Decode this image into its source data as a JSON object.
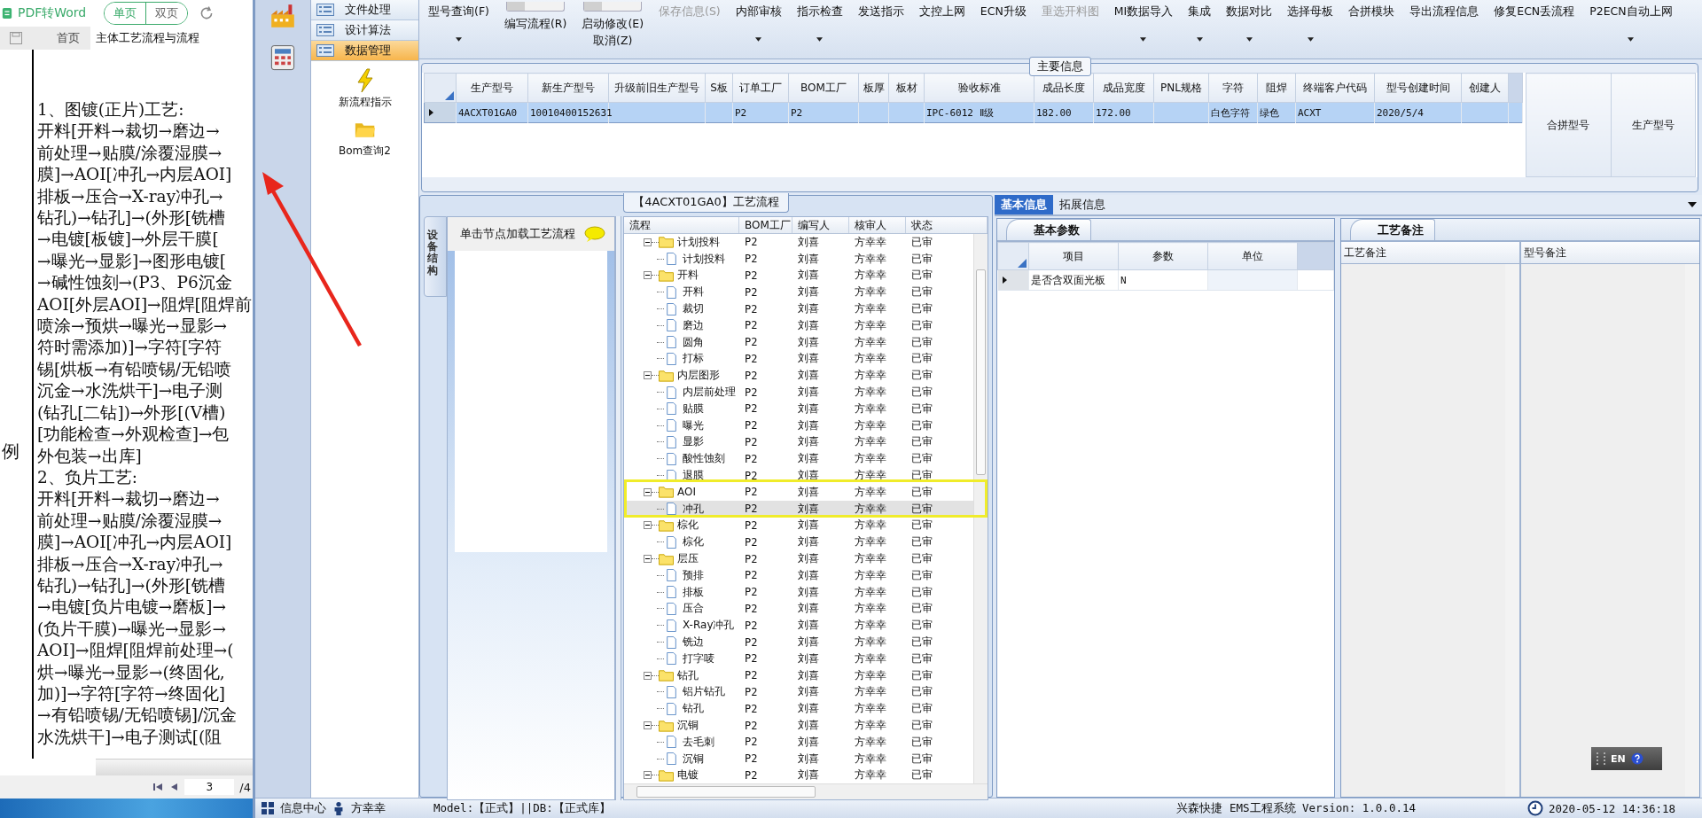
{
  "doc_viewer": {
    "convert_button": "PDF转Word",
    "view_modes": [
      {
        "label": "单页",
        "selected": true
      },
      {
        "label": "双页",
        "selected": false
      }
    ],
    "tabs": [
      {
        "label": "首页",
        "selected": false
      },
      {
        "label": "主体工艺流程与流程",
        "selected": true
      }
    ],
    "margin_note": "例",
    "lines": [
      "1、图镀(正片)工艺:",
      "开料[开料→裁切→磨边→",
      "前处理→贴膜/涂覆湿膜→",
      "膜]→AOI[冲孔→内层AOI]",
      "排板→压合→X-ray冲孔→",
      "钻孔)→钻孔]→(外形[铣槽",
      "→电镀[板镀]→外层干膜[",
      "→曝光→显影]→图形电镀[",
      "→碱性蚀刻→(P3、P6沉金",
      "AOI[外层AOI]→阻焊[阻焊前",
      "喷涂→预烘→曝光→显影→",
      "符时需添加)]→字符[字符",
      "锡[烘板→有铅喷锡/无铅喷",
      "沉金→水洗烘干]→电子测",
      "(钻孔[二钻])→外形[(V槽)",
      "[功能检查→外观检查]→包",
      "外包装→出库]",
      "2、负片工艺:",
      "开料[开料→裁切→磨边→",
      "前处理→贴膜/涂覆湿膜→",
      "膜]→AOI[冲孔→内层AOI]",
      "排板→压合→X-ray冲孔→",
      "钻孔)→钻孔]→(外形[铣槽",
      "→电镀[负片电镀→磨板]→",
      "(负片干膜)→曝光→显影→",
      "AOI]→阻焊[阻焊前处理→(",
      "烘→曝光→显影→(终固化,",
      "加)]→字符[字符→终固化]",
      "→有铅喷锡/无铅喷锡]/沉金",
      "水洗烘干]→电子测试[(阻"
    ],
    "page_input": "3",
    "page_total": "/4"
  },
  "nav": {
    "menu": [
      {
        "label": "文件处理",
        "selected": false
      },
      {
        "label": "设计算法",
        "selected": false
      },
      {
        "label": "数据管理",
        "selected": true
      }
    ],
    "tools": [
      {
        "kind": "lightning",
        "label": "新流程指示"
      },
      {
        "kind": "folder",
        "label": "Bom查询2"
      }
    ]
  },
  "toolbar": [
    {
      "kind": "button",
      "label": "型号查询(F)",
      "dropdown": true,
      "disabled": false
    },
    {
      "kind": "toggle",
      "label": "编写流程(R)",
      "on": false
    },
    {
      "kind": "toggle",
      "label": "启动修改(E)",
      "sublabel": "取消(Z)",
      "on": false
    },
    {
      "kind": "button",
      "label": "保存信息(S)",
      "dropdown": false,
      "disabled": true
    },
    {
      "kind": "button",
      "label": "内部审核",
      "dropdown": true,
      "disabled": false
    },
    {
      "kind": "button",
      "label": "指示检查",
      "dropdown": true,
      "disabled": false
    },
    {
      "kind": "button",
      "label": "发送指示",
      "dropdown": false,
      "disabled": false
    },
    {
      "kind": "button",
      "label": "文控上网",
      "dropdown": false,
      "disabled": false
    },
    {
      "kind": "button",
      "label": "ECN升级",
      "dropdown": false,
      "disabled": false
    },
    {
      "kind": "button",
      "label": "重选开料图",
      "dropdown": false,
      "disabled": true
    },
    {
      "kind": "button",
      "label": "MI数据导入",
      "dropdown": true,
      "disabled": false
    },
    {
      "kind": "button",
      "label": "集成",
      "dropdown": true,
      "disabled": false
    },
    {
      "kind": "button",
      "label": "数据对比",
      "dropdown": true,
      "disabled": false
    },
    {
      "kind": "button",
      "label": "选择母板",
      "dropdown": true,
      "disabled": false
    },
    {
      "kind": "button",
      "label": "合拼模块",
      "dropdown": false,
      "disabled": false
    },
    {
      "kind": "button",
      "label": "导出流程信息",
      "dropdown": false,
      "disabled": false
    },
    {
      "kind": "button",
      "label": "修复ECN丢流程",
      "dropdown": false,
      "disabled": false
    },
    {
      "kind": "button",
      "label": "P2ECN自动上网",
      "dropdown": true,
      "disabled": false
    }
  ],
  "main_info": {
    "title": "主要信息",
    "columns": [
      "生产型号",
      "新生产型号",
      "升级前旧生产型号",
      "S板",
      "订单工厂",
      "BOM工厂",
      "板厚",
      "板材",
      "验收标准",
      "成品长度",
      "成品宽度",
      "PNL规格",
      "字符",
      "阻焊",
      "终端客户代码",
      "型号创建时间",
      "创建人"
    ],
    "rows": [
      {
        "selected": true,
        "cells": [
          "4ACXT01GA0",
          "10010400152631",
          null,
          null,
          "P2",
          "P2",
          null,
          null,
          "IPC-6012 Ⅱ级",
          "182.00",
          "172.00",
          null,
          "白色字符",
          "绿色",
          "ACXT",
          "2020/5/4",
          null
        ]
      }
    ],
    "side_columns": [
      "合拼型号",
      "生产型号"
    ]
  },
  "process_flow": {
    "title": "【4ACXT01GA0】工艺流程",
    "side_tab": "设备结构",
    "hint": "单击节点加载工艺流程",
    "columns": [
      "流程",
      "BOM工厂",
      "编写人",
      "核审人",
      "状态"
    ],
    "tree": [
      {
        "label": "计划投料",
        "bom": "P2",
        "author": "刘喜",
        "reviewer": "方幸幸",
        "status": "已审",
        "selected": false,
        "expanded": true,
        "children": [
          {
            "label": "计划投料",
            "bom": "P2",
            "author": "刘喜",
            "reviewer": "方幸幸",
            "status": "已审",
            "selected": false
          }
        ]
      },
      {
        "label": "开料",
        "bom": "P2",
        "author": "刘喜",
        "reviewer": "方幸幸",
        "status": "已审",
        "selected": false,
        "expanded": true,
        "children": [
          {
            "label": "开料",
            "bom": "P2",
            "author": "刘喜",
            "reviewer": "方幸幸",
            "status": "已审",
            "selected": false
          },
          {
            "label": "裁切",
            "bom": "P2",
            "author": "刘喜",
            "reviewer": "方幸幸",
            "status": "已审",
            "selected": false
          },
          {
            "label": "磨边",
            "bom": "P2",
            "author": "刘喜",
            "reviewer": "方幸幸",
            "status": "已审",
            "selected": false
          },
          {
            "label": "圆角",
            "bom": "P2",
            "author": "刘喜",
            "reviewer": "方幸幸",
            "status": "已审",
            "selected": false
          },
          {
            "label": "打标",
            "bom": "P2",
            "author": "刘喜",
            "reviewer": "方幸幸",
            "status": "已审",
            "selected": false
          }
        ]
      },
      {
        "label": "内层图形",
        "bom": "P2",
        "author": "刘喜",
        "reviewer": "方幸幸",
        "status": "已审",
        "selected": false,
        "expanded": true,
        "children": [
          {
            "label": "内层前处理",
            "bom": "P2",
            "author": "刘喜",
            "reviewer": "方幸幸",
            "status": "已审",
            "selected": false
          },
          {
            "label": "贴膜",
            "bom": "P2",
            "author": "刘喜",
            "reviewer": "方幸幸",
            "status": "已审",
            "selected": false
          },
          {
            "label": "曝光",
            "bom": "P2",
            "author": "刘喜",
            "reviewer": "方幸幸",
            "status": "已审",
            "selected": false
          },
          {
            "label": "显影",
            "bom": "P2",
            "author": "刘喜",
            "reviewer": "方幸幸",
            "status": "已审",
            "selected": false
          },
          {
            "label": "酸性蚀刻",
            "bom": "P2",
            "author": "刘喜",
            "reviewer": "方幸幸",
            "status": "已审",
            "selected": false
          },
          {
            "label": "退膜",
            "bom": "P2",
            "author": "刘喜",
            "reviewer": "方幸幸",
            "status": "已审",
            "selected": false
          }
        ]
      },
      {
        "label": "AOI",
        "bom": "P2",
        "author": "刘喜",
        "reviewer": "方幸幸",
        "status": "已审",
        "selected": false,
        "expanded": true,
        "children": [
          {
            "label": "冲孔",
            "bom": "P2",
            "author": "刘喜",
            "reviewer": "方幸幸",
            "status": "已审",
            "selected": true
          }
        ]
      },
      {
        "label": "棕化",
        "bom": "P2",
        "author": "刘喜",
        "reviewer": "方幸幸",
        "status": "已审",
        "selected": false,
        "expanded": true,
        "children": [
          {
            "label": "棕化",
            "bom": "P2",
            "author": "刘喜",
            "reviewer": "方幸幸",
            "status": "已审",
            "selected": false
          }
        ]
      },
      {
        "label": "层压",
        "bom": "P2",
        "author": "刘喜",
        "reviewer": "方幸幸",
        "status": "已审",
        "selected": false,
        "expanded": true,
        "children": [
          {
            "label": "预排",
            "bom": "P2",
            "author": "刘喜",
            "reviewer": "方幸幸",
            "status": "已审",
            "selected": false
          },
          {
            "label": "排板",
            "bom": "P2",
            "author": "刘喜",
            "reviewer": "方幸幸",
            "status": "已审",
            "selected": false
          },
          {
            "label": "压合",
            "bom": "P2",
            "author": "刘喜",
            "reviewer": "方幸幸",
            "status": "已审",
            "selected": false
          },
          {
            "label": "X-Ray冲孔",
            "bom": "P2",
            "author": "刘喜",
            "reviewer": "方幸幸",
            "status": "已审",
            "selected": false
          },
          {
            "label": "铣边",
            "bom": "P2",
            "author": "刘喜",
            "reviewer": "方幸幸",
            "status": "已审",
            "selected": false
          },
          {
            "label": "打字唛",
            "bom": "P2",
            "author": "刘喜",
            "reviewer": "方幸幸",
            "status": "已审",
            "selected": false
          }
        ]
      },
      {
        "label": "钻孔",
        "bom": "P2",
        "author": "刘喜",
        "reviewer": "方幸幸",
        "status": "已审",
        "selected": false,
        "expanded": true,
        "children": [
          {
            "label": "铝片钻孔",
            "bom": "P2",
            "author": "刘喜",
            "reviewer": "方幸幸",
            "status": "已审",
            "selected": false
          },
          {
            "label": "钻孔",
            "bom": "P2",
            "author": "刘喜",
            "reviewer": "方幸幸",
            "status": "已审",
            "selected": false
          }
        ]
      },
      {
        "label": "沉铜",
        "bom": "P2",
        "author": "刘喜",
        "reviewer": "方幸幸",
        "status": "已审",
        "selected": false,
        "expanded": true,
        "children": [
          {
            "label": "去毛刺",
            "bom": "P2",
            "author": "刘喜",
            "reviewer": "方幸幸",
            "status": "已审",
            "selected": false
          },
          {
            "label": "沉铜",
            "bom": "P2",
            "author": "刘喜",
            "reviewer": "方幸幸",
            "status": "已审",
            "selected": false
          }
        ]
      },
      {
        "label": "电镀",
        "bom": "P2",
        "author": "刘喜",
        "reviewer": "方幸幸",
        "status": "已审",
        "selected": false,
        "expanded": true
      }
    ]
  },
  "detail_tabs": [
    {
      "label": "基本信息",
      "selected": true
    },
    {
      "label": "拓展信息",
      "selected": false
    }
  ],
  "basic_params": {
    "tab": "基本参数",
    "columns": [
      "项目",
      "参数",
      "单位"
    ],
    "rows": [
      {
        "item": "是否含双面光板",
        "value": "N"
      }
    ]
  },
  "process_notes": {
    "tab": "工艺备注",
    "columns": [
      "工艺备注",
      "型号备注"
    ]
  },
  "language_bar": {
    "label": "EN"
  },
  "status_bar": {
    "info_center": "信息中心",
    "user": "方幸幸",
    "model_db": "Model:【正式】||DB:【正式库】",
    "product": "兴森快捷 EMS工程系统 Version: 1.0.0.14",
    "datetime": "2020-05-12 14:36:18"
  }
}
